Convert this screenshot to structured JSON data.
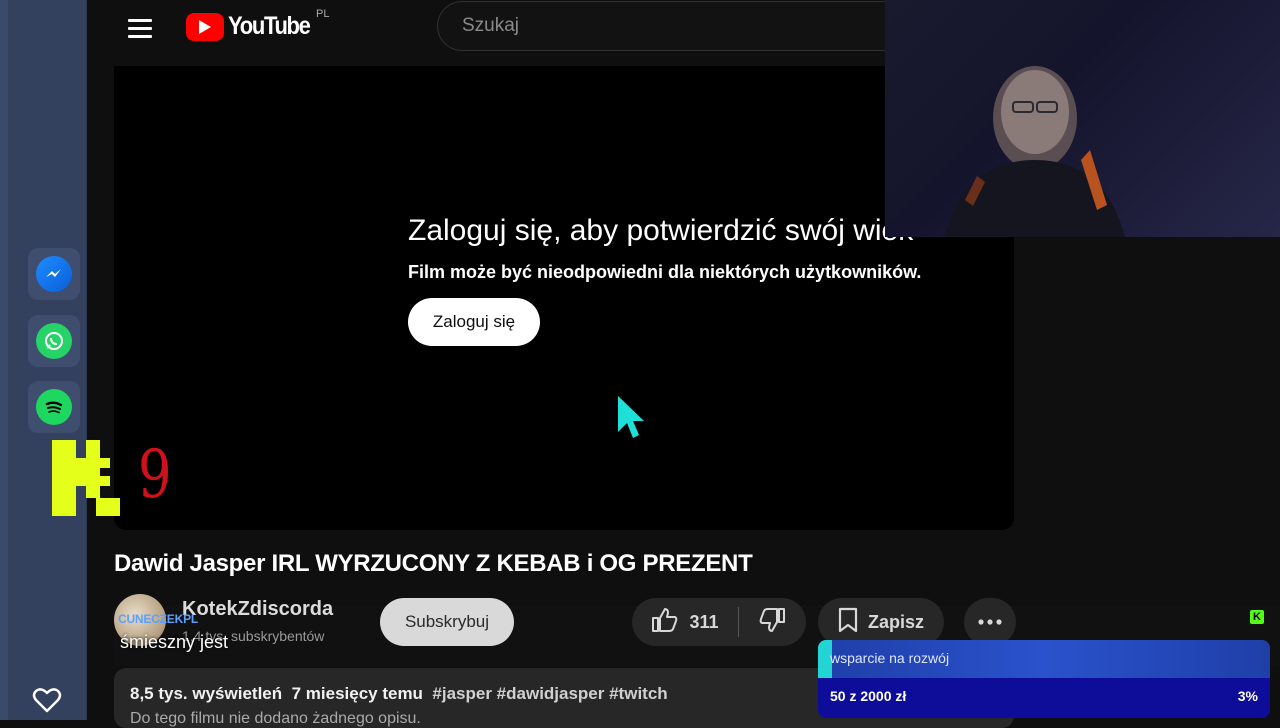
{
  "header": {
    "logo_text": "YouTube",
    "region": "PL",
    "search_placeholder": "Szukaj"
  },
  "player": {
    "age_gate_title": "Zaloguj się, aby potwierdzić swój wiek",
    "age_gate_subtitle": "Film może być nieodpowiedni dla niektórych użytkowników.",
    "signin_label": "Zaloguj się"
  },
  "video": {
    "title": "Dawid Jasper IRL WYRZUCONY Z KEBAB i OG PREZENT",
    "channel_name": "KotekZdiscorda",
    "channel_subs": "1,4 tys. subskrybentów",
    "subscribe_label": "Subskrybuj",
    "like_count": "311",
    "save_label": "Zapisz",
    "views": "8,5 tys. wyświetleń",
    "age": "7 miesięcy temu",
    "hashtags": "#jasper #dawidjasper #twitch",
    "description_text": "Do tego filmu nie dodano żadnego opisu."
  },
  "stream_overlay": {
    "k_counter": "9",
    "chat_username": "CUNECZEKPL",
    "chat_message": "śmieszny jest",
    "goal_label": "wsparcie na rozwój",
    "goal_amount": "50 z 2000 zł",
    "goal_percent": "3%",
    "goal_progress": 0.03
  },
  "dock": {
    "apps": [
      "messenger-icon",
      "whatsapp-icon",
      "spotify-icon"
    ]
  },
  "colors": {
    "youtube_red": "#ff0000",
    "kick_green": "#53fc18",
    "counter_red": "#d0101a",
    "cursor_cyan": "#1fe0d8",
    "goal_blue": "#0d0d9a"
  }
}
